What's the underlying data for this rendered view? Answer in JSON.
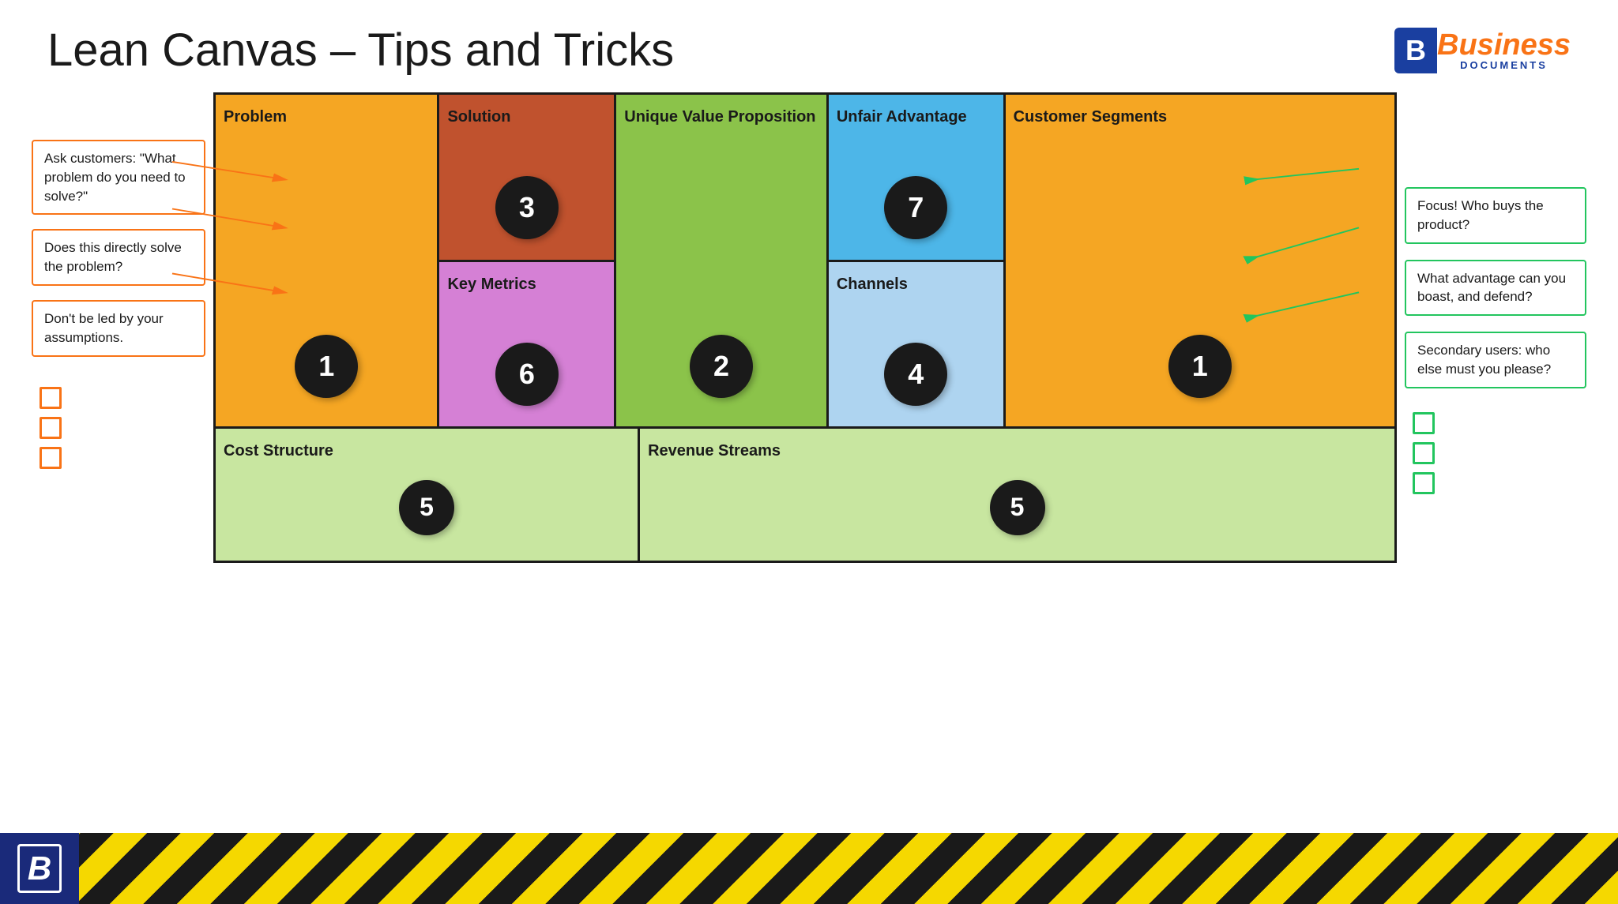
{
  "header": {
    "title": "Lean Canvas – Tips and Tricks",
    "logo": {
      "business": "Business",
      "documents": "DOCUMENTS"
    }
  },
  "canvas": {
    "cells": {
      "problem": {
        "label": "Problem",
        "number": "1",
        "color": "#f5a623"
      },
      "solution": {
        "label": "Solution",
        "number": "3",
        "color": "#c0522e"
      },
      "key_metrics": {
        "label": "Key Metrics",
        "number": "6",
        "color": "#d580d5"
      },
      "uvp": {
        "label": "Unique Value Proposition",
        "number": "2",
        "color": "#8bc34a"
      },
      "unfair": {
        "label": "Unfair Advantage",
        "number": "7",
        "color": "#4db6e8"
      },
      "channels": {
        "label": "Channels",
        "number": "4",
        "color": "#aed4f0"
      },
      "segments": {
        "label": "Customer Segments",
        "number": "1",
        "color": "#f5a623"
      },
      "cost": {
        "label": "Cost Structure",
        "number": "5",
        "color": "#c8e6a0"
      },
      "revenue": {
        "label": "Revenue Streams",
        "number": "5",
        "color": "#c8e6a0"
      }
    }
  },
  "left_annotations": [
    {
      "text": "Ask customers: \"What problem do you need to solve?\""
    },
    {
      "text": "Does this directly solve the problem?"
    },
    {
      "text": "Don't be led by your assumptions."
    }
  ],
  "right_annotations": [
    {
      "text": "Focus!\nWho buys the product?"
    },
    {
      "text": "What advantage can you boast, and defend?"
    },
    {
      "text": "Secondary users: who else must you please?"
    }
  ],
  "left_checkboxes": 3,
  "right_checkboxes": 3,
  "bottom_bar": {
    "logo_letter": "B"
  }
}
